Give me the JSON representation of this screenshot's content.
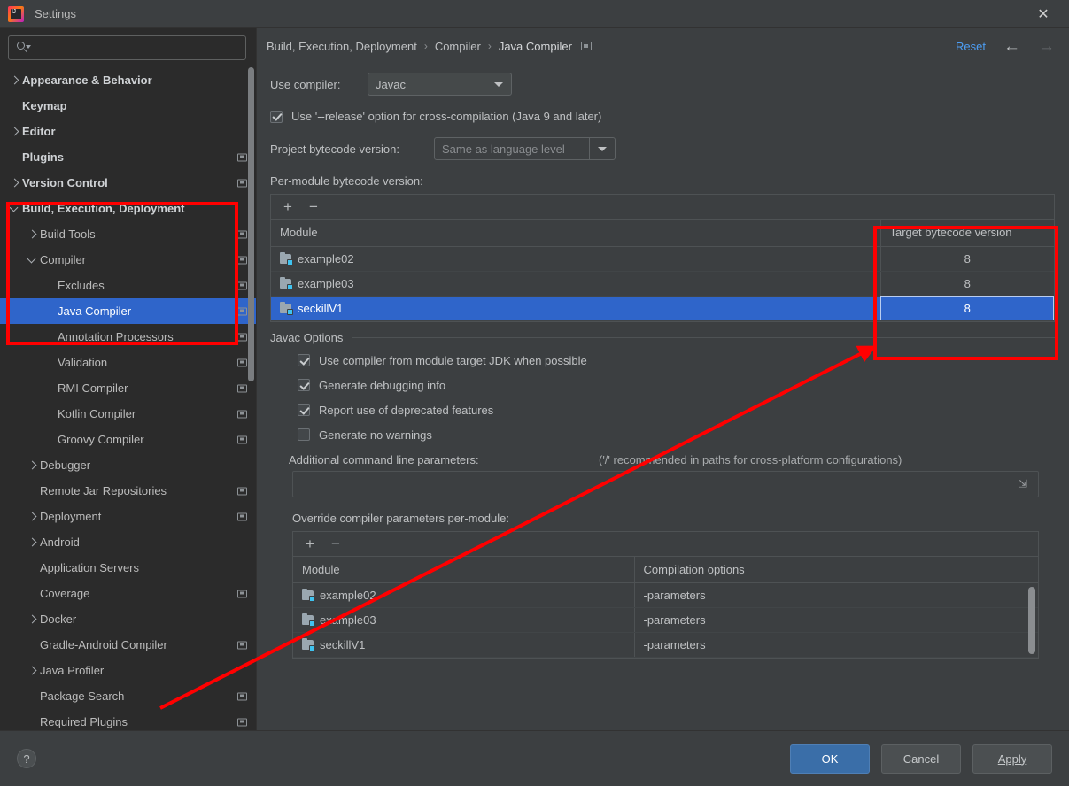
{
  "window": {
    "title": "Settings",
    "logo_icon": "intellij-idea-logo",
    "close_icon": "close-icon"
  },
  "sidebar": {
    "search": {
      "placeholder": "",
      "value": "",
      "icon": "search-icon",
      "caret_icon": "chevron-down-icon"
    },
    "items": [
      {
        "label": "Appearance & Behavior",
        "indent": 0,
        "twisty": "collapsed",
        "bold": true,
        "cfg": false,
        "selected": false
      },
      {
        "label": "Keymap",
        "indent": 0,
        "twisty": "none",
        "bold": true,
        "cfg": false,
        "selected": false
      },
      {
        "label": "Editor",
        "indent": 0,
        "twisty": "collapsed",
        "bold": true,
        "cfg": false,
        "selected": false
      },
      {
        "label": "Plugins",
        "indent": 0,
        "twisty": "none",
        "bold": true,
        "cfg": true,
        "selected": false
      },
      {
        "label": "Version Control",
        "indent": 0,
        "twisty": "collapsed",
        "bold": true,
        "cfg": true,
        "selected": false
      },
      {
        "label": "Build, Execution, Deployment",
        "indent": 0,
        "twisty": "expanded",
        "bold": true,
        "cfg": false,
        "selected": false
      },
      {
        "label": "Build Tools",
        "indent": 1,
        "twisty": "collapsed",
        "bold": false,
        "cfg": true,
        "selected": false
      },
      {
        "label": "Compiler",
        "indent": 1,
        "twisty": "expanded",
        "bold": false,
        "cfg": true,
        "selected": false
      },
      {
        "label": "Excludes",
        "indent": 2,
        "twisty": "none",
        "bold": false,
        "cfg": true,
        "selected": false
      },
      {
        "label": "Java Compiler",
        "indent": 2,
        "twisty": "none",
        "bold": false,
        "cfg": true,
        "selected": true
      },
      {
        "label": "Annotation Processors",
        "indent": 2,
        "twisty": "none",
        "bold": false,
        "cfg": true,
        "selected": false
      },
      {
        "label": "Validation",
        "indent": 2,
        "twisty": "none",
        "bold": false,
        "cfg": true,
        "selected": false
      },
      {
        "label": "RMI Compiler",
        "indent": 2,
        "twisty": "none",
        "bold": false,
        "cfg": true,
        "selected": false
      },
      {
        "label": "Kotlin Compiler",
        "indent": 2,
        "twisty": "none",
        "bold": false,
        "cfg": true,
        "selected": false
      },
      {
        "label": "Groovy Compiler",
        "indent": 2,
        "twisty": "none",
        "bold": false,
        "cfg": true,
        "selected": false
      },
      {
        "label": "Debugger",
        "indent": 1,
        "twisty": "collapsed",
        "bold": false,
        "cfg": false,
        "selected": false
      },
      {
        "label": "Remote Jar Repositories",
        "indent": 1,
        "twisty": "none",
        "bold": false,
        "cfg": true,
        "selected": false
      },
      {
        "label": "Deployment",
        "indent": 1,
        "twisty": "collapsed",
        "bold": false,
        "cfg": true,
        "selected": false
      },
      {
        "label": "Android",
        "indent": 1,
        "twisty": "collapsed",
        "bold": false,
        "cfg": false,
        "selected": false
      },
      {
        "label": "Application Servers",
        "indent": 1,
        "twisty": "none",
        "bold": false,
        "cfg": false,
        "selected": false
      },
      {
        "label": "Coverage",
        "indent": 1,
        "twisty": "none",
        "bold": false,
        "cfg": true,
        "selected": false
      },
      {
        "label": "Docker",
        "indent": 1,
        "twisty": "collapsed",
        "bold": false,
        "cfg": false,
        "selected": false
      },
      {
        "label": "Gradle-Android Compiler",
        "indent": 1,
        "twisty": "none",
        "bold": false,
        "cfg": true,
        "selected": false
      },
      {
        "label": "Java Profiler",
        "indent": 1,
        "twisty": "collapsed",
        "bold": false,
        "cfg": false,
        "selected": false
      },
      {
        "label": "Package Search",
        "indent": 1,
        "twisty": "none",
        "bold": false,
        "cfg": true,
        "selected": false
      },
      {
        "label": "Required Plugins",
        "indent": 1,
        "twisty": "none",
        "bold": false,
        "cfg": true,
        "selected": false
      }
    ]
  },
  "breadcrumb": {
    "parts": [
      "Build, Execution, Deployment",
      "Compiler",
      "Java Compiler"
    ],
    "separator": "›",
    "cfg_icon": "project-settings-icon",
    "reset_label": "Reset",
    "back_icon": "arrow-left-icon",
    "forward_icon": "arrow-right-icon"
  },
  "main": {
    "use_compiler_label": "Use compiler:",
    "use_compiler_value": "Javac",
    "release_option_label": "Use '--release' option for cross-compilation (Java 9 and later)",
    "release_option_checked": true,
    "project_bytecode_label": "Project bytecode version:",
    "project_bytecode_value": "Same as language level",
    "per_module_label": "Per-module bytecode version:",
    "toolbar_add": "+",
    "toolbar_remove": "−",
    "bytecode_table": {
      "columns": [
        "Module",
        "Target bytecode version"
      ],
      "rows": [
        {
          "module": "example02",
          "version": "8",
          "selected": false
        },
        {
          "module": "example03",
          "version": "8",
          "selected": false
        },
        {
          "module": "seckillV1",
          "version": "8",
          "selected": true
        }
      ]
    },
    "javac_options_title": "Javac Options",
    "javac_checkboxes": [
      {
        "label": "Use compiler from module target JDK when possible",
        "checked": true
      },
      {
        "label": "Generate debugging info",
        "checked": true
      },
      {
        "label": "Report use of deprecated features",
        "checked": true
      },
      {
        "label": "Generate no warnings",
        "checked": false
      }
    ],
    "additional_params_label": "Additional command line parameters:",
    "additional_params_hint": "('/' recommended in paths for cross-platform configurations)",
    "additional_params_value": "",
    "expand_icon": "expand-icon",
    "override_label": "Override compiler parameters per-module:",
    "override_table": {
      "columns": [
        "Module",
        "Compilation options"
      ],
      "rows": [
        {
          "module": "example02",
          "options": "-parameters"
        },
        {
          "module": "example03",
          "options": "-parameters"
        },
        {
          "module": "seckillV1",
          "options": "-parameters"
        }
      ]
    }
  },
  "footer": {
    "help_label": "?",
    "ok_label": "OK",
    "cancel_label": "Cancel",
    "apply_label": "Apply"
  },
  "annotations": {
    "color": "#ff0000",
    "sidebar_box": "highlights Build, Execution, Deployment → Java Compiler",
    "column_box": "highlights Target bytecode version column",
    "arrow": "points from sidebar area to the selected target bytecode cell"
  },
  "colors": {
    "accent_selection": "#2f65ca",
    "link": "#4d9ef5",
    "annotation": "#ff0000",
    "panel_bg": "#3c3f41",
    "sidebar_bg": "#2b2b2b"
  }
}
